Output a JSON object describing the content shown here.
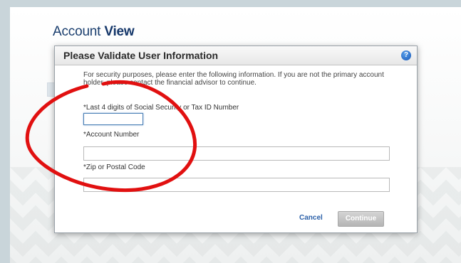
{
  "page": {
    "title_prefix": "Account ",
    "title_emphasis": "View"
  },
  "dialog": {
    "title": "Please Validate User Information",
    "help_icon_glyph": "?",
    "intro": "For security purposes, please enter the following information. If you are not the primary account holder, please contact the financial advisor to continue.",
    "fields": {
      "ssn_label": "*Last 4 digits of Social Security or Tax ID Number",
      "ssn_value": "",
      "account_label": "*Account Number",
      "account_value": "",
      "zip_label": "*Zip or Postal Code",
      "zip_value": ""
    },
    "actions": {
      "cancel": "Cancel",
      "continue": "Continue"
    }
  },
  "colors": {
    "title_blue": "#1a3e6e",
    "link_blue": "#2a5fa8",
    "help_icon_blue": "#1657b8",
    "annotation_red": "#e11010",
    "disabled_button": "#b5b5b5"
  },
  "annotation": {
    "shape": "ellipse",
    "color": "#e11010"
  }
}
